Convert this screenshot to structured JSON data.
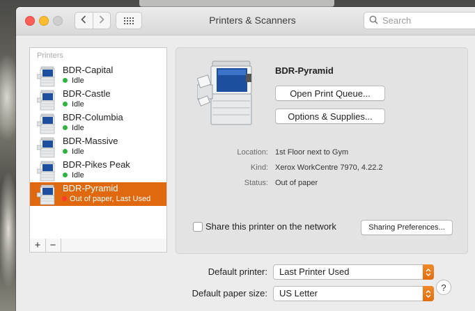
{
  "window": {
    "title": "Printers & Scanners"
  },
  "toolbar": {
    "back_icon": "chevron-left-icon",
    "forward_icon": "chevron-right-icon",
    "grid_icon": "grid-icon",
    "search_placeholder": "Search"
  },
  "printers": {
    "header": "Printers",
    "items": [
      {
        "name": "BDR-Capital",
        "status": "Idle",
        "status_color": "#2fb33f"
      },
      {
        "name": "BDR-Castle",
        "status": "Idle",
        "status_color": "#2fb33f"
      },
      {
        "name": "BDR-Columbia",
        "status": "Idle",
        "status_color": "#2fb33f"
      },
      {
        "name": "BDR-Massive",
        "status": "Idle",
        "status_color": "#2fb33f"
      },
      {
        "name": "BDR-Pikes Peak",
        "status": "Idle",
        "status_color": "#2fb33f"
      },
      {
        "name": "BDR-Pyramid",
        "status": "Out of paper, Last Used",
        "status_color": "#ff3b30",
        "selected": true
      }
    ],
    "add_label": "+",
    "remove_label": "−"
  },
  "detail": {
    "name": "BDR-Pyramid",
    "open_queue_label": "Open Print Queue...",
    "options_label": "Options & Supplies...",
    "location_label": "Location:",
    "location_value": "1st Floor next to Gym",
    "kind_label": "Kind:",
    "kind_value": "Xerox WorkCentre 7970, 4.22.2",
    "status_label": "Status:",
    "status_value": "Out of paper",
    "share_label": "Share this printer on the network",
    "share_checked": false,
    "sharing_prefs_label": "Sharing Preferences..."
  },
  "defaults": {
    "printer_label": "Default printer:",
    "printer_value": "Last Printer Used",
    "paper_label": "Default paper size:",
    "paper_value": "US Letter"
  },
  "help_label": "?",
  "colors": {
    "selection": "#e0680e",
    "accent": "#e26d10"
  }
}
